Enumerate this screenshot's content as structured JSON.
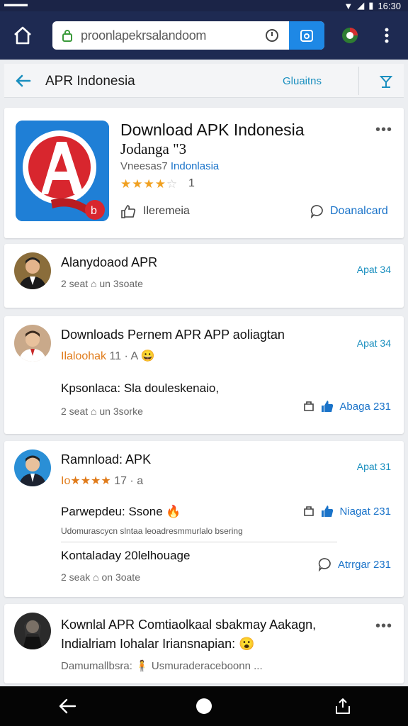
{
  "statusbar": {
    "left": "▬▬▬",
    "time": "16:30"
  },
  "browser": {
    "url": "proonlapekrsalandoom"
  },
  "header": {
    "title": "APR Indonesia",
    "action": "Gluaitns"
  },
  "app_card": {
    "title": "Download APK Indonesia",
    "subtitle": "Jodanga \"3",
    "developer_prefix": "Vneesas7",
    "developer_accent": "Indonlasia",
    "stars_filled": "★★★★",
    "stars_empty": "☆",
    "rating_count": "1",
    "share_label": "Ileremeia",
    "download_label": "Doanalcard",
    "more": "•••"
  },
  "posts": [
    {
      "title": "Alanydoaod APR",
      "meta": "2 seat  ⌂ un  3soate",
      "date": "Apat 34"
    },
    {
      "title": "Downloads Pernem APR APP aoliagtan",
      "sub_orange": "Ilaloohak",
      "sub_rest": "11 · A",
      "emoji": "😀",
      "date": "Apat 34",
      "body": "Kpsonlaca: Sla douleskenaio,",
      "meta": "2 seat  ⌂ un  3sorke",
      "like": "Abaga 231"
    },
    {
      "title": "Ramnload: APK",
      "sub_orange": "Iо★★★★",
      "sub_rest": "17 · a",
      "date": "Apat 31",
      "body": "Parwepdeu: Ssone",
      "emoji": "🔥",
      "like": "Niagat 231",
      "small": "Udomurascycn slntaa leoadresmmurlalo bsering",
      "body2": "Kontaladay 20lelhouage",
      "meta": "2 seak  ⌂ on  3oate",
      "like2": "Atrrgar 231"
    },
    {
      "title": "Kownlal APR Comtiaolkaal sbakmay Aakagn, Indialriam Iohalar Iriansnapian:",
      "emoji": "😮",
      "small": "Damumallbsra: 🧍 Usmuraderaceboonn ...",
      "more": "•••"
    }
  ],
  "colors": {
    "chrome": "#1e2a52",
    "accent": "#1a73c9",
    "star": "#f0a020"
  }
}
